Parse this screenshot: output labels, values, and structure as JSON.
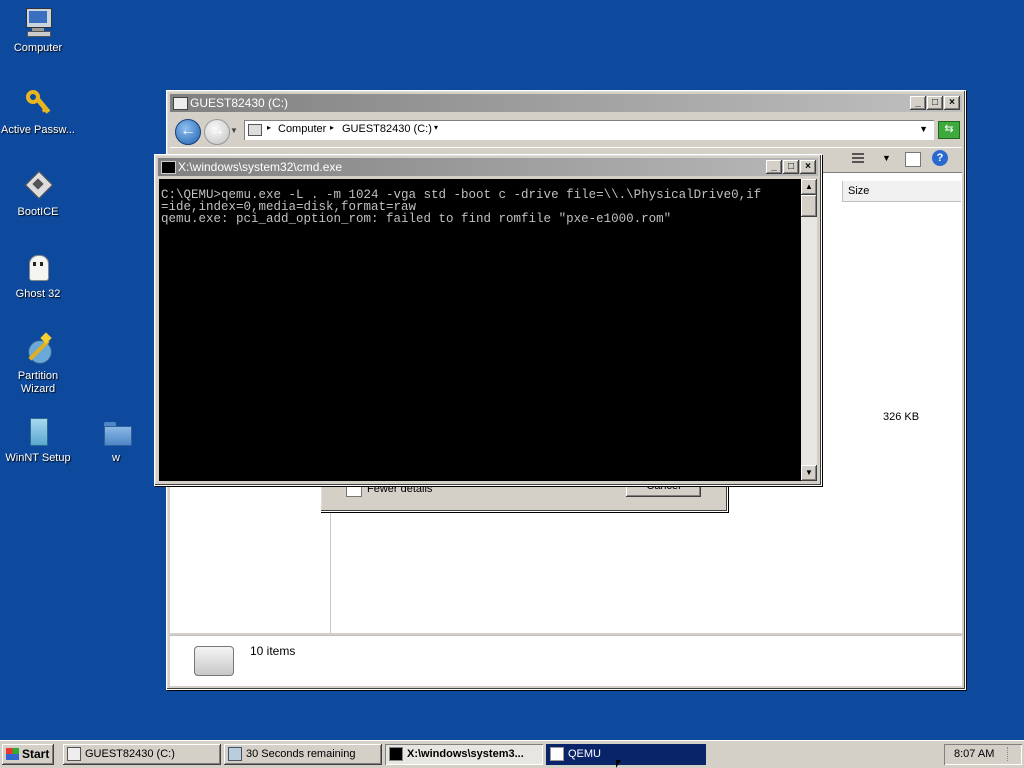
{
  "desktop": {
    "icons": [
      {
        "label": "Computer"
      },
      {
        "label": "Active Passw..."
      },
      {
        "label": "BootICE"
      },
      {
        "label": "Ghost 32"
      },
      {
        "label": "Partition Wizard"
      },
      {
        "label": "WinNT Setup"
      },
      {
        "label": "w"
      }
    ]
  },
  "explorer": {
    "title": "GUEST82430 (C:)",
    "address": {
      "part1": "Computer",
      "part2": "GUEST82430 (C:)"
    },
    "column_size": "Size",
    "row_size": "326 KB",
    "status_count": "10 items"
  },
  "copy_dialog": {
    "fewer_details": "Fewer details",
    "cancel": "Cancel"
  },
  "cmd": {
    "title": "X:\\windows\\system32\\cmd.exe",
    "lines": [
      "C:\\QEMU>qemu.exe -L . -m 1024 -vga std -boot c -drive file=\\\\.\\PhysicalDrive0,if",
      "=ide,index=0,media=disk,format=raw",
      "qemu.exe: pci_add_option_rom: failed to find romfile \"pxe-e1000.rom\""
    ]
  },
  "taskbar": {
    "start": "Start",
    "items": [
      {
        "label": "GUEST82430 (C:)"
      },
      {
        "label": "30 Seconds remaining"
      },
      {
        "label": "X:\\windows\\system3..."
      },
      {
        "label": "QEMU"
      }
    ],
    "clock": "8:07 AM"
  },
  "colors": {
    "desktop": "#0d4a9e",
    "task_active": "#0a246a"
  }
}
